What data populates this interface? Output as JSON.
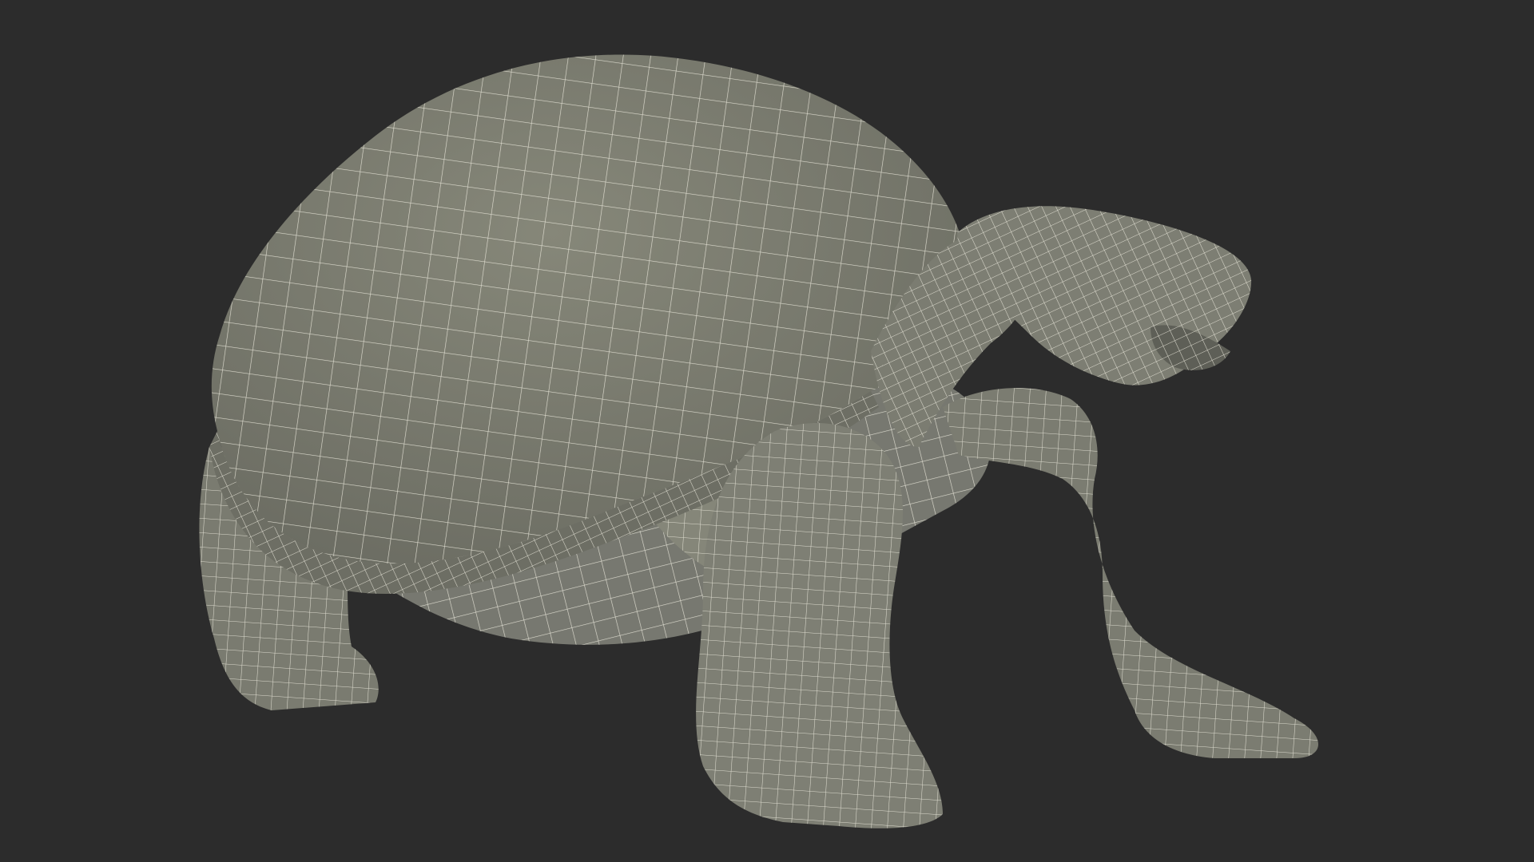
{
  "scene": {
    "subject": "tortoise-wireframe-model",
    "colors": {
      "background": "#2c2c2c",
      "surface": "#7a7b70",
      "surface_light": "#85867b",
      "surface_dark": "#6a6b61",
      "wire": "#efece0"
    },
    "view": {
      "mode": "wireframe-on-shaded"
    }
  }
}
